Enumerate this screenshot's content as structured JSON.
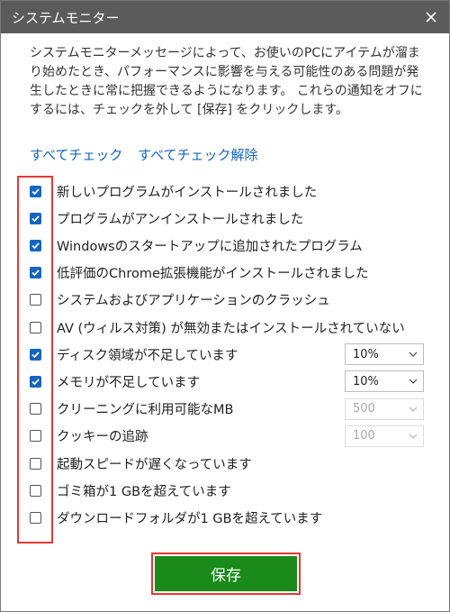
{
  "window": {
    "title": "システムモニター"
  },
  "description": "システムモニターメッセージによって、お使いのPCにアイテムが溜まり始めたとき、パフォーマンスに影響を与える可能性のある問題が発生したときに常に把握できるようになります。 これらの通知をオフにするには、チェックを外して [保存] をクリックします。",
  "links": {
    "check_all": "すべてチェック",
    "uncheck_all": "すべてチェック解除"
  },
  "items": [
    {
      "label": "新しいプログラムがインストールされました",
      "checked": true
    },
    {
      "label": "プログラムがアンインストールされました",
      "checked": true
    },
    {
      "label": "Windowsのスタートアップに追加されたプログラム",
      "checked": true
    },
    {
      "label": "低評価のChrome拡張機能がインストールされました",
      "checked": true
    },
    {
      "label": "システムおよびアプリケーションのクラッシュ",
      "checked": false
    },
    {
      "label": "AV (ウィルス対策) が無効またはインストールされていない",
      "checked": false
    },
    {
      "label": "ディスク領域が不足しています",
      "checked": true,
      "select": "10%",
      "select_enabled": true
    },
    {
      "label": "メモリが不足しています",
      "checked": true,
      "select": "10%",
      "select_enabled": true
    },
    {
      "label": "クリーニングに利用可能なMB",
      "checked": false,
      "select": "500",
      "select_enabled": false
    },
    {
      "label": "クッキーの追跡",
      "checked": false,
      "select": "100",
      "select_enabled": false
    },
    {
      "label": "起動スピードが遅くなっています",
      "checked": false
    },
    {
      "label": "ゴミ箱が1 GBを超えています",
      "checked": false
    },
    {
      "label": "ダウンロードフォルダが1 GBを超えています",
      "checked": false
    }
  ],
  "save_label": "保存",
  "colors": {
    "titlebar": "#5b5b5b",
    "checkbox_checked": "#1565c0",
    "save_button": "#1a8a1a",
    "highlight": "#e53935",
    "link": "#1565c0"
  }
}
